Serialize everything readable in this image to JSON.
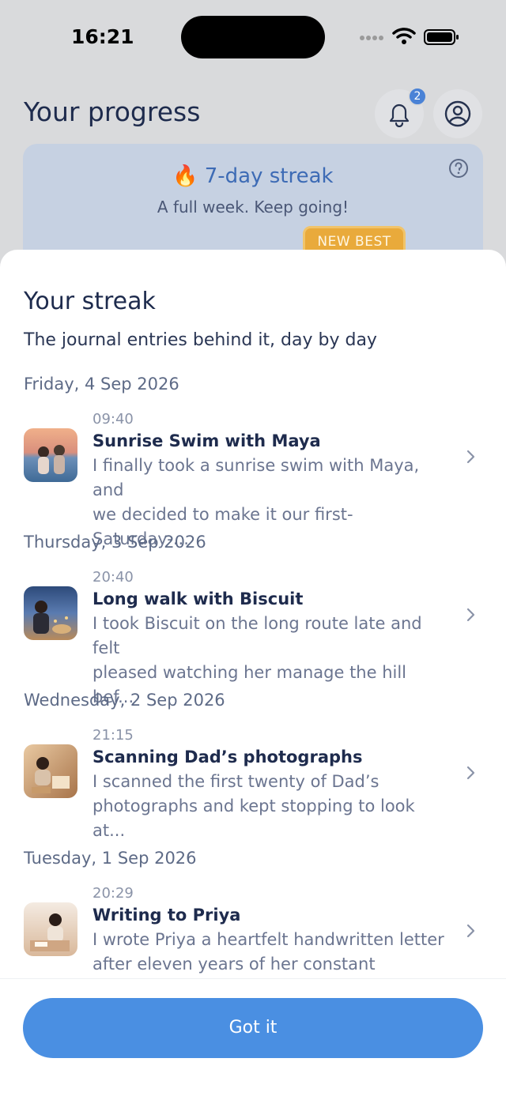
{
  "status_bar": {
    "time": "16:21"
  },
  "header": {
    "title": "Your progress",
    "notification_count": "2"
  },
  "streak_card": {
    "streak_label": "7-day streak",
    "subtitle": "A full week. Keep going!",
    "badge": "NEW BEST"
  },
  "sheet": {
    "title": "Your streak",
    "subtitle": "The journal entries behind it, day by day",
    "days": [
      {
        "date": "Friday, 4 Sep 2026",
        "time": "09:40",
        "title": "Sunrise Swim with Maya",
        "snippet_line1": "I finally took a sunrise swim with Maya, and",
        "snippet_line2": "we decided to make it our first-Saturday-..."
      },
      {
        "date": "Thursday, 3 Sep 2026",
        "time": "20:40",
        "title": "Long walk with Biscuit",
        "snippet_line1": "I took Biscuit on the long route late and felt",
        "snippet_line2": "pleased watching her manage the hill bef..."
      },
      {
        "date": "Wednesday, 2 Sep 2026",
        "time": "21:15",
        "title": "Scanning Dad’s photographs",
        "snippet_line1": "I scanned the first twenty of Dad’s",
        "snippet_line2": "photographs and kept stopping to look at..."
      },
      {
        "date": "Tuesday, 1 Sep 2026",
        "time": "20:29",
        "title": "Writing to Priya",
        "snippet_line1": "I wrote Priya a heartfelt handwritten letter",
        "snippet_line2": "after eleven years of her constant suppor..."
      }
    ],
    "button_label": "Got it"
  },
  "colors": {
    "accent": "#4a8fe2",
    "badge": "#e9aa3b",
    "streak_text": "#3d6bb5"
  }
}
